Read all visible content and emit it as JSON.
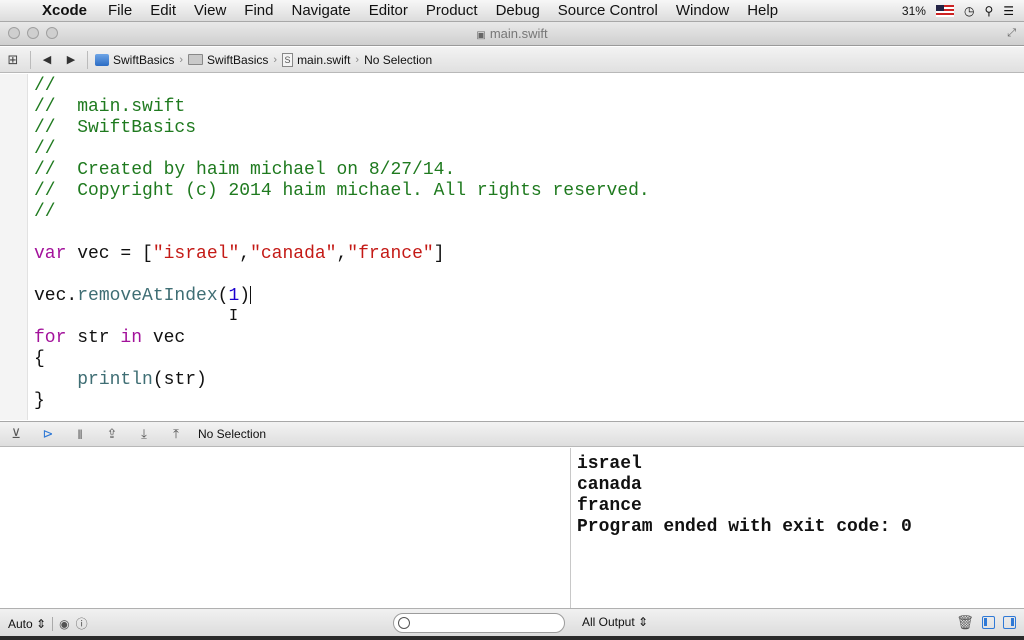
{
  "menubar": {
    "apple": "",
    "items": [
      "Xcode",
      "File",
      "Edit",
      "View",
      "Find",
      "Navigate",
      "Editor",
      "Product",
      "Debug",
      "Source Control",
      "Window",
      "Help"
    ],
    "battery": "31%"
  },
  "window": {
    "title": "main.swift"
  },
  "jumpbar": {
    "project": "SwiftBasics",
    "group": "SwiftBasics",
    "file": "main.swift",
    "selection": "No Selection"
  },
  "code": {
    "l1": "//",
    "l2": "//  main.swift",
    "l3": "//  SwiftBasics",
    "l4": "//",
    "l5": "//  Created by haim michael on 8/27/14.",
    "l6": "//  Copyright (c) 2014 haim michael. All rights reserved.",
    "l7": "//",
    "var_kw": "var",
    "var_decl": " vec = [",
    "str1": "\"israel\"",
    "str2": "\"canada\"",
    "str3": "\"france\"",
    "comma": ",",
    "close_bracket": "]",
    "call_obj": "vec.",
    "call_fn": "removeAtIndex",
    "paren_open": "(",
    "arg": "1",
    "paren_close": ")",
    "for_kw": "for",
    "for_var": " str ",
    "in_kw": "in",
    "for_seq": " vec",
    "brace_open": "{",
    "indent": "    ",
    "println": "println",
    "println_args": "(str)",
    "brace_close": "}"
  },
  "debugbar": {
    "selection": "No Selection"
  },
  "console": {
    "lines": [
      "israel",
      "canada",
      "france",
      "Program ended with exit code: 0"
    ]
  },
  "bottombar": {
    "scope": "Auto",
    "output": "All Output"
  }
}
